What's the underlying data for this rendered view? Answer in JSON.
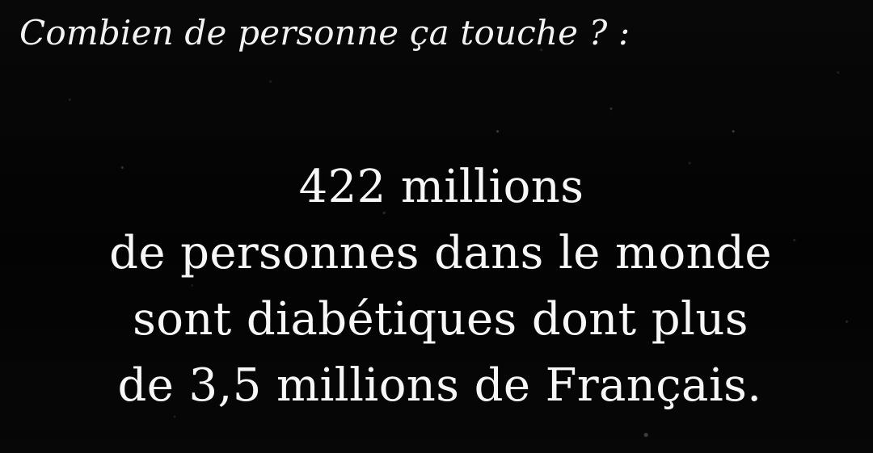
{
  "headline": "Combien de personne ça touche ? :",
  "message": {
    "line_1": "422 millions",
    "line_2": "de personnes dans le monde",
    "line_3": "sont diabétiques dont plus",
    "line_4": "de 3,5 millions de Français."
  },
  "colors": {
    "background": "#050505",
    "text": "#f7f7f7"
  }
}
